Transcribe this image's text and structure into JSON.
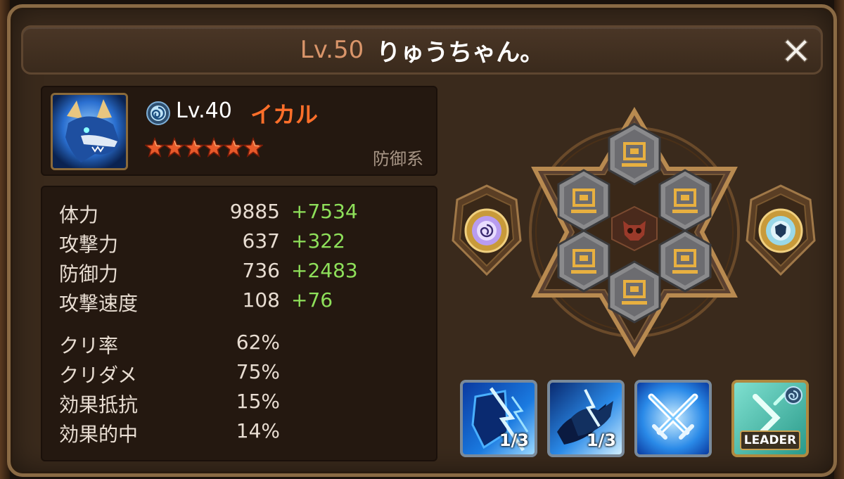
{
  "header": {
    "level": "Lv.50",
    "player_name": "りゅうちゃん。"
  },
  "monster": {
    "element": "wind-icon",
    "level": "Lv.40",
    "name": "イカル",
    "stars": 6,
    "type": "防御系"
  },
  "stats": [
    {
      "label": "体力",
      "base": "9885",
      "bonus": "+7534"
    },
    {
      "label": "攻撃力",
      "base": "637",
      "bonus": "+322"
    },
    {
      "label": "防御力",
      "base": "736",
      "bonus": "+2483"
    },
    {
      "label": "攻撃速度",
      "base": "108",
      "bonus": "+76"
    },
    {
      "label": "クリ率",
      "base": "62%",
      "bonus": ""
    },
    {
      "label": "クリダメ",
      "base": "75%",
      "bonus": ""
    },
    {
      "label": "効果抵抗",
      "base": "15%",
      "bonus": ""
    },
    {
      "label": "効果的中",
      "base": "14%",
      "bonus": ""
    }
  ],
  "skills": [
    {
      "name": "skill-1",
      "count": "1/3"
    },
    {
      "name": "skill-2",
      "count": "1/3"
    },
    {
      "name": "skill-3",
      "count": ""
    }
  ],
  "leader": {
    "label": "LEADER"
  },
  "colors": {
    "title_level": "#d9956a",
    "monster_name": "#ff6f2a",
    "bonus": "#8ee05a"
  }
}
